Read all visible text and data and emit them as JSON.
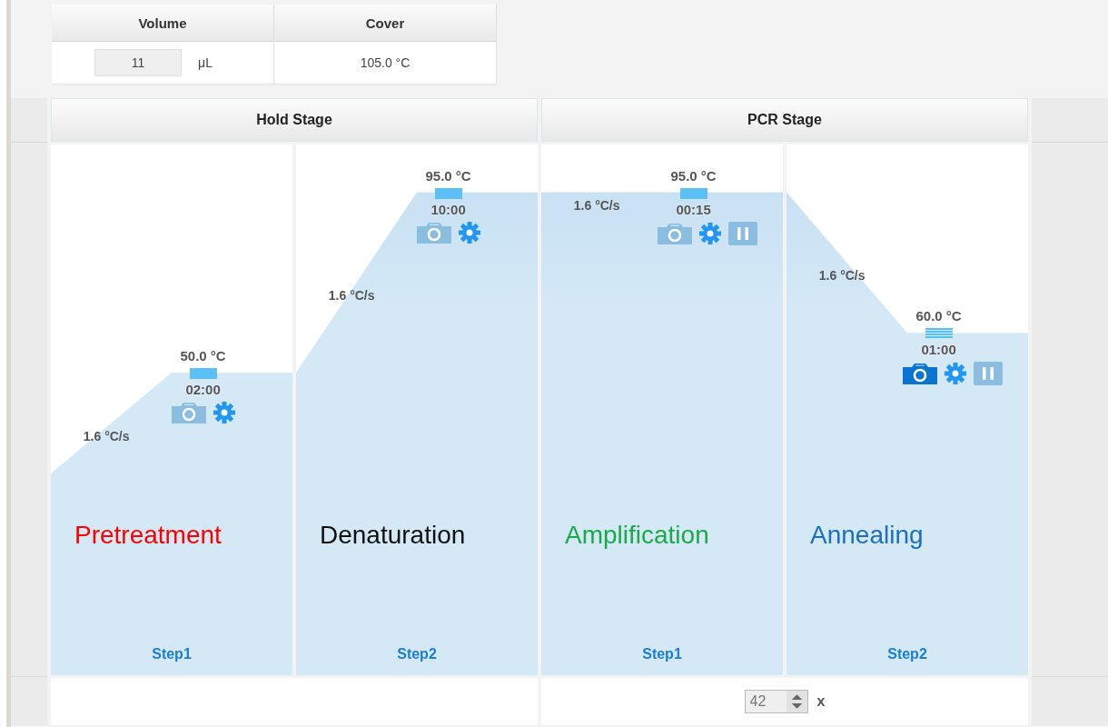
{
  "run_settings": {
    "columns": [
      "Volume",
      "Cover"
    ],
    "volume": "11",
    "volume_unit": "μL",
    "cover": "105.0 °C"
  },
  "stages": [
    {
      "title": "Hold Stage",
      "steps": [
        {
          "label": "Step1",
          "name": "Pretreatment",
          "color": "#ff0000",
          "temperature": "50.0 °C",
          "time": "02:00",
          "ramp_rate": "1.6 °C/s",
          "level": 0.57,
          "data_collection": false,
          "pause": false
        },
        {
          "label": "Step2",
          "name": "Denaturation",
          "color": "#111111",
          "temperature": "95.0 °C",
          "time": "10:00",
          "ramp_rate": "1.6 °C/s",
          "level": 0.91,
          "data_collection": false,
          "pause": false
        }
      ]
    },
    {
      "title": "PCR Stage",
      "steps": [
        {
          "label": "Step1",
          "name": "Amplification",
          "color": "#1aaa4a",
          "temperature": "95.0 °C",
          "time": "00:15",
          "ramp_rate": "1.6 °C/s",
          "level": 0.91,
          "data_collection": false,
          "pause": true
        },
        {
          "label": "Step2",
          "name": "Annealing",
          "color": "#1a6fc0",
          "temperature": "60.0 °C",
          "time": "01:00",
          "ramp_rate": "1.6 °C/s",
          "level": 0.645,
          "data_collection": true,
          "pause": true
        }
      ],
      "footer": {
        "cycles": "42",
        "times_sign": "x"
      }
    }
  ]
}
